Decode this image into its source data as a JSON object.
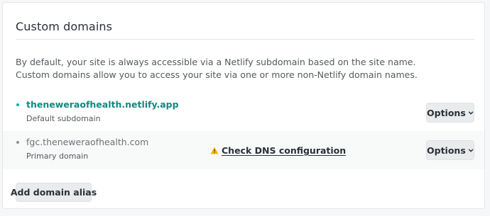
{
  "section": {
    "title": "Custom domains",
    "description_lines": [
      "By default, your site is always accessible via a Netlify subdomain based on the site name.",
      "Custom domains allow you to access your site via one or more non-Netlify domain names."
    ]
  },
  "domains": [
    {
      "name": "theneweraofhealth.netlify.app",
      "subtitle": "Default subdomain",
      "options_label": "Options",
      "bullet_color": "#00ad9f",
      "name_color": "#0e8a83"
    },
    {
      "name": "fgc.theneweraofhealth.com",
      "subtitle": "Primary domain",
      "options_label": "Options",
      "bullet_color": "#8a9095",
      "name_color": "#6d7378",
      "dns_check": {
        "icon": "warning-icon",
        "label": "Check DNS configuration",
        "icon_color": "#f5b700"
      }
    }
  ],
  "actions": {
    "add_alias_label": "Add domain alias"
  }
}
